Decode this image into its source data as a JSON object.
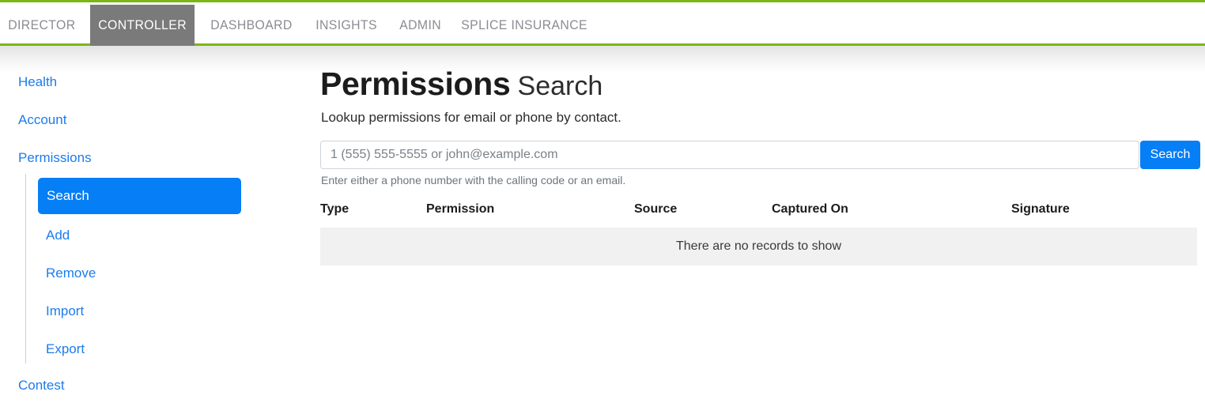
{
  "topnav": {
    "items": [
      {
        "label": "DIRECTOR",
        "active": false
      },
      {
        "label": "CONTROLLER",
        "active": true
      },
      {
        "label": "DASHBOARD",
        "active": false
      },
      {
        "label": "INSIGHTS",
        "active": false
      },
      {
        "label": "ADMIN",
        "active": false
      },
      {
        "label": "SPLICE INSURANCE",
        "active": false
      }
    ],
    "accent_color": "#7cb518",
    "active_bg": "#7a7a7a",
    "inactive_text_color": "#8b8b93"
  },
  "sidebar": {
    "items": [
      {
        "label": "Health"
      },
      {
        "label": "Account"
      },
      {
        "label": "Permissions"
      },
      {
        "label": "Contest"
      }
    ],
    "subitems": [
      {
        "label": "Search",
        "active": true
      },
      {
        "label": "Add",
        "active": false
      },
      {
        "label": "Remove",
        "active": false
      },
      {
        "label": "Import",
        "active": false
      },
      {
        "label": "Export",
        "active": false
      }
    ],
    "link_color": "#1b7ced",
    "active_bg": "#067ef6"
  },
  "main": {
    "title_strong": "Permissions",
    "title_light": "Search",
    "subtitle": "Lookup permissions for email or phone by contact.",
    "search": {
      "value": "",
      "placeholder": "1 (555) 555-5555 or john@example.com",
      "button_label": "Search",
      "hint": "Enter either a phone number with the calling code or an email."
    },
    "table": {
      "columns": [
        "Type",
        "Permission",
        "Source",
        "Captured On",
        "Signature"
      ],
      "rows": [],
      "empty_message": "There are no records to show",
      "empty_row_bg": "#f1f1f1"
    }
  }
}
